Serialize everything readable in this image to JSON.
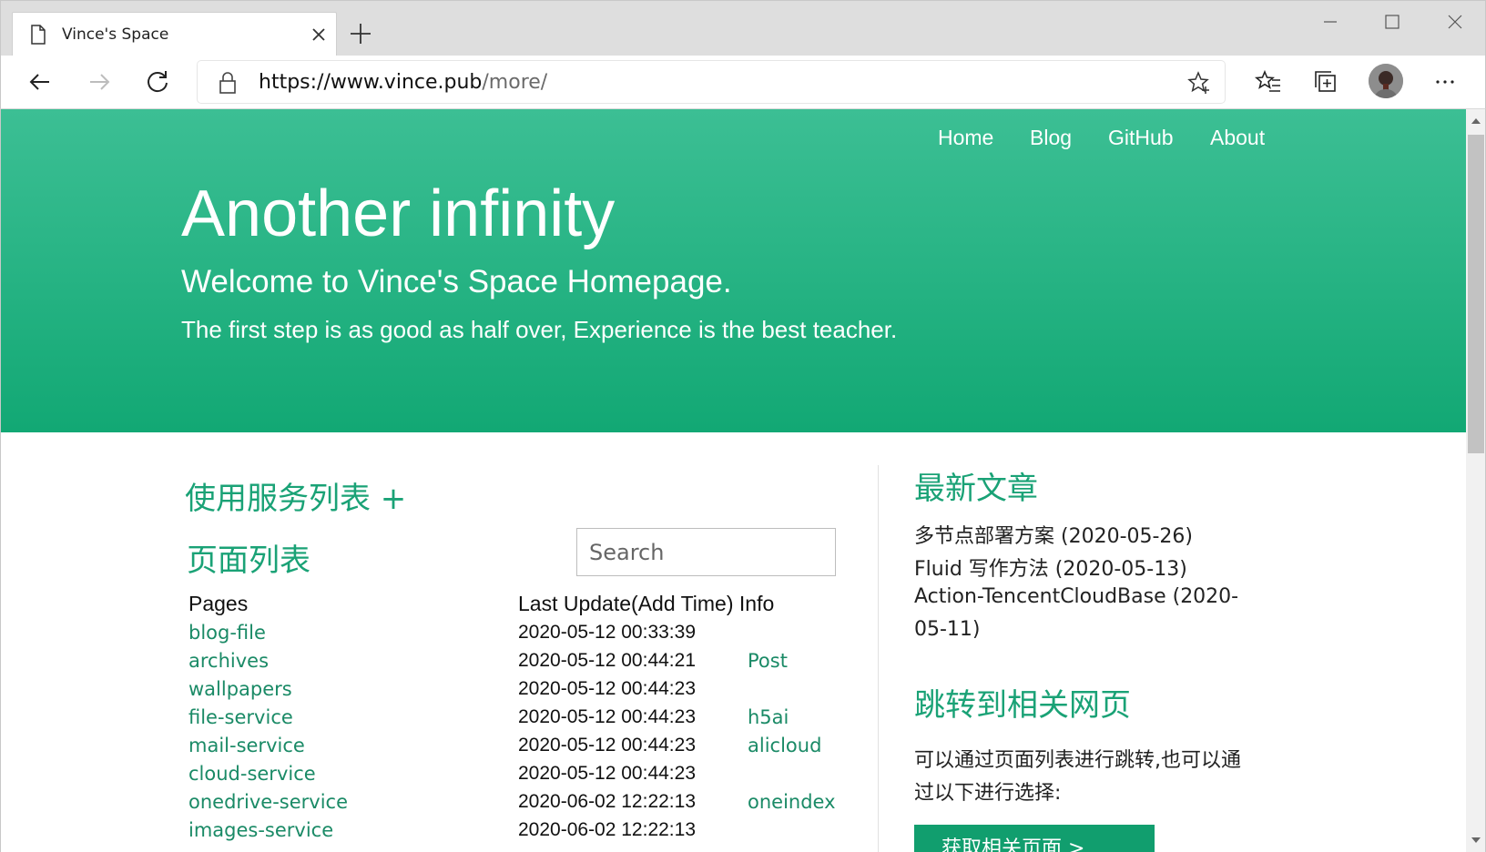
{
  "browser": {
    "tab_title": "Vince's Space",
    "url_host": "https://www.vince.pub",
    "url_path": "/more/"
  },
  "site": {
    "nav": [
      "Home",
      "Blog",
      "GitHub",
      "About"
    ],
    "hero_title": "Another infinity",
    "hero_subtitle": "Welcome to Vince's Space Homepage.",
    "hero_quote": "The first step is as good as half over, Experience is the best teacher."
  },
  "services": {
    "heading": "使用服务列表 +"
  },
  "pages": {
    "heading": "页面列表",
    "search_placeholder": "Search",
    "col_pages": "Pages",
    "col_time": "Last Update(Add Time) Info",
    "rows": [
      {
        "page": "blog-file",
        "time": "2020-05-12 00:33:39",
        "info": ""
      },
      {
        "page": "archives",
        "time": "2020-05-12 00:44:21",
        "info": "Post"
      },
      {
        "page": "wallpapers",
        "time": "2020-05-12 00:44:23",
        "info": ""
      },
      {
        "page": "file-service",
        "time": "2020-05-12 00:44:23",
        "info": "h5ai"
      },
      {
        "page": "mail-service",
        "time": "2020-05-12 00:44:23",
        "info": "alicloud"
      },
      {
        "page": "cloud-service",
        "time": "2020-05-12 00:44:23",
        "info": ""
      },
      {
        "page": "onedrive-service",
        "time": "2020-06-02 12:22:13",
        "info": "oneindex"
      },
      {
        "page": "images-service",
        "time": "2020-06-02 12:22:13",
        "info": ""
      }
    ]
  },
  "latest": {
    "heading": "最新文章",
    "articles": [
      "多节点部署方案 (2020-05-26)",
      "Fluid 写作方法 (2020-05-13)",
      "Action-TencentCloudBase (2020-",
      "05-11)"
    ]
  },
  "jump": {
    "heading": "跳转到相关网页",
    "line1": "可以通过页面列表进行跳转,也可以通",
    "line2": "过以下进行选择:",
    "button": "获取相关页面 >"
  },
  "colors": {
    "hero_top": "#3cbf94",
    "hero_bottom": "#12a874",
    "accent": "#1aa276",
    "link": "#1a8a66"
  }
}
